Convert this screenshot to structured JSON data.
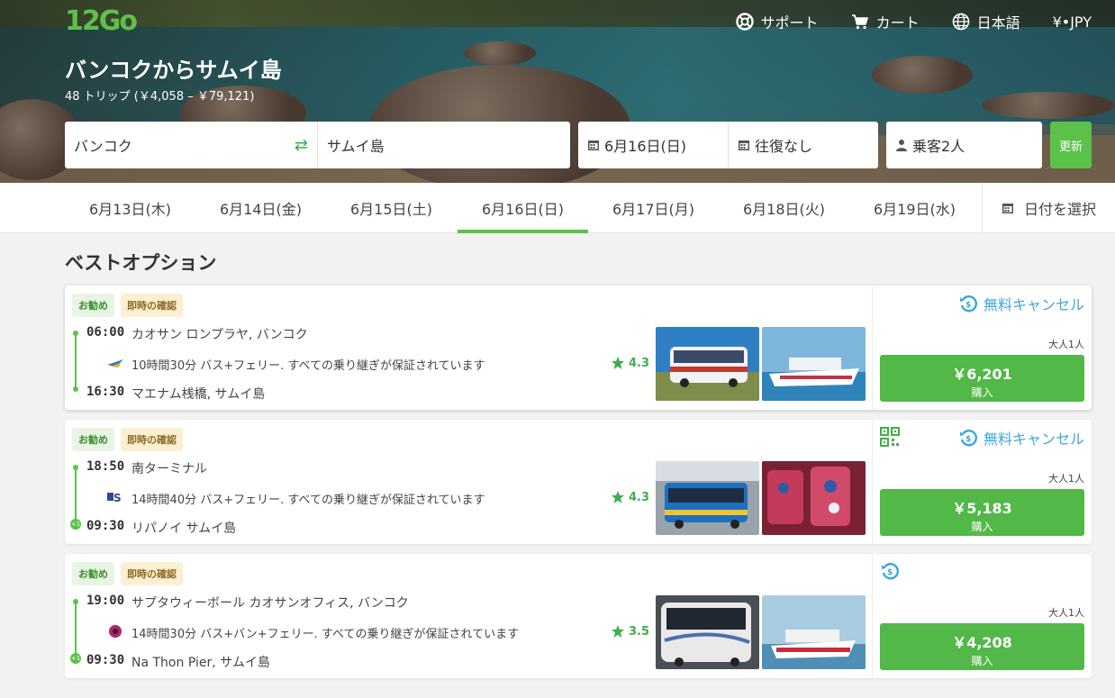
{
  "header": {
    "logo_text": "12Go",
    "nav": {
      "support": "サポート",
      "cart": "カート",
      "language": "日本語",
      "currency": "¥•JPY"
    },
    "title": "バンコクからサムイ島",
    "subtitle": "48 トリップ (￥4,058 – ￥79,121)"
  },
  "search": {
    "from": "バンコク",
    "to": "サムイ島",
    "date": "6月16日(日)",
    "return": "往復なし",
    "passengers": "乗客2人",
    "update": "更新"
  },
  "dates": {
    "tabs": [
      {
        "label": "6月13日(木)"
      },
      {
        "label": "6月14日(金)"
      },
      {
        "label": "6月15日(土)"
      },
      {
        "label": "6月16日(日)",
        "active": true
      },
      {
        "label": "6月17日(月)"
      },
      {
        "label": "6月18日(火)"
      },
      {
        "label": "6月19日(水)"
      }
    ],
    "pick": "日付を選択"
  },
  "section_title": "ベストオプション",
  "trips": [
    {
      "badge_rec": "お勧め",
      "badge_confirm": "即時の確認",
      "dep_time": "06:00",
      "dep_place": "カオサン ロンプラヤ, バンコク",
      "summary": "10時間30分 バス+フェリー. すべての乗り継ぎが保証されています",
      "rating": "4.3",
      "arr_time": "16:30",
      "arr_place": "マエナム桟橋, サムイ島",
      "free_cancel": "無料キャンセル",
      "pax": "大人1人",
      "price": "￥6,201",
      "buy": "購入"
    },
    {
      "badge_rec": "お勧め",
      "badge_confirm": "即時の確認",
      "dep_time": "18:50",
      "dep_place": "南ターミナル",
      "summary": "14時間40分 バス+フェリー. すべての乗り継ぎが保証されています",
      "rating": "4.3",
      "arr_time": "09:30",
      "arr_place": "リパノイ サムイ島",
      "free_cancel": "無料キャンセル",
      "pax": "大人1人",
      "price": "￥5,183",
      "buy": "購入",
      "plus_day": "+1"
    },
    {
      "badge_rec": "お勧め",
      "badge_confirm": "即時の確認",
      "dep_time": "19:00",
      "dep_place": "サプタウィーボール カオサンオフィス, バンコク",
      "summary": "14時間30分 バス+バン+フェリー. すべての乗り継ぎが保証されています",
      "rating": "3.5",
      "arr_time": "09:30",
      "arr_place": "Na Thon Pier, サムイ島",
      "pax": "大人1人",
      "price": "￥4,208",
      "buy": "購入",
      "plus_day": "+1"
    }
  ],
  "colors": {
    "brand_green": "#5cc14b",
    "cancel_blue": "#3ba8d8",
    "badge_rec_bg": "#e9f5e4",
    "badge_confirm_bg": "#fcefd2"
  }
}
